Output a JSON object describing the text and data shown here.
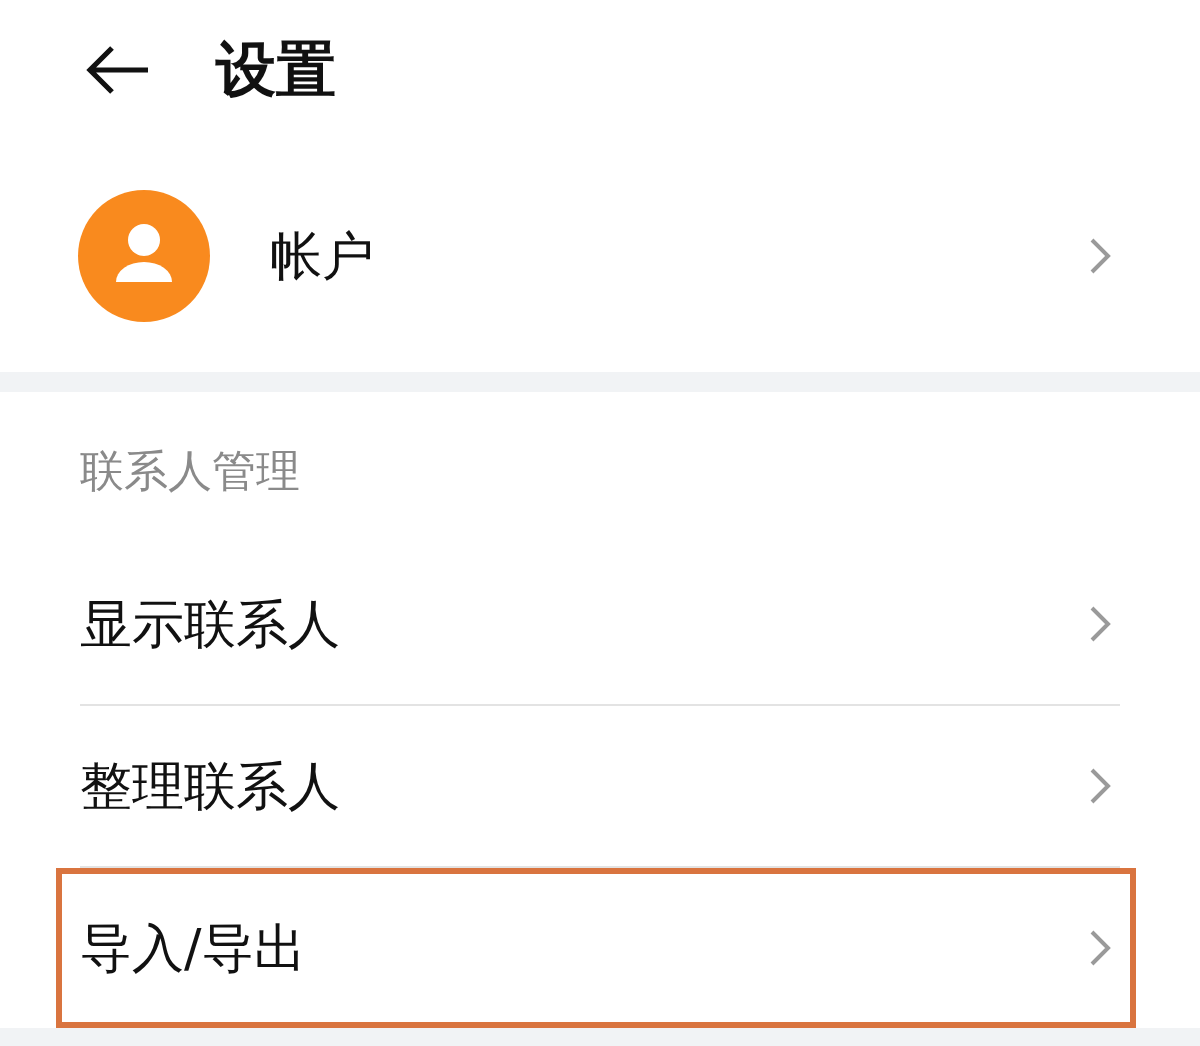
{
  "header": {
    "title": "设置"
  },
  "account": {
    "label": "帐户"
  },
  "sections": [
    {
      "title": "联系人管理",
      "items": [
        {
          "label": "显示联系人",
          "highlighted": false
        },
        {
          "label": "整理联系人",
          "highlighted": false
        },
        {
          "label": "导入/导出",
          "highlighted": true
        }
      ]
    }
  ]
}
